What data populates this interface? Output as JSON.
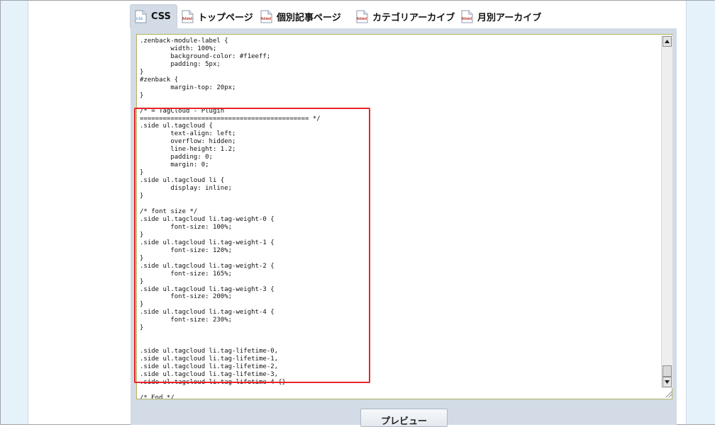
{
  "tabs": [
    {
      "label": "CSS",
      "icon": "css-file-icon",
      "icon_text": "css",
      "active": true
    },
    {
      "label": "トップページ",
      "icon": "html-file-icon",
      "icon_text": "html",
      "active": false
    },
    {
      "label": "個別記事ページ",
      "icon": "html-file-icon",
      "icon_text": "html",
      "active": false
    },
    {
      "label": "カテゴリアーカイブ",
      "icon": "html-file-icon",
      "icon_text": "html",
      "active": false
    },
    {
      "label": "月別アーカイブ",
      "icon": "html-file-icon",
      "icon_text": "html",
      "active": false
    }
  ],
  "editor": {
    "code": ".zenback-module-label {\n        width: 100%;\n        background-color: #f1eeff;\n        padding: 5px;\n}\n#zenback {\n        margin-top: 20px;\n}\n\n/* = TagCloud - Plugin\n============================================ */\n.side ul.tagcloud {\n        text-align: left;\n        overflow: hidden;\n        line-height: 1.2;\n        padding: 0;\n        margin: 0;\n}\n.side ul.tagcloud li {\n        display: inline;\n}\n\n/* font size */\n.side ul.tagcloud li.tag-weight-0 {\n        font-size: 100%;\n}\n.side ul.tagcloud li.tag-weight-1 {\n        font-size: 120%;\n}\n.side ul.tagcloud li.tag-weight-2 {\n        font-size: 165%;\n}\n.side ul.tagcloud li.tag-weight-3 {\n        font-size: 200%;\n}\n.side ul.tagcloud li.tag-weight-4 {\n        font-size: 230%;\n}\n\n\n.side ul.tagcloud li.tag-lifetime-0,\n.side ul.tagcloud li.tag-lifetime-1,\n.side ul.tagcloud li.tag-lifetime-2,\n.side ul.tagcloud li.tag-lifetime-3,\n.side ul.tagcloud li.tag-lifetime-4 {}\n\n/* End */"
  },
  "buttons": {
    "preview_label": "プレビュー"
  },
  "colors": {
    "highlight": "#e8242a",
    "panel": "#d2dbe6",
    "css_icon": "#3a7fc1",
    "html_icon": "#c0392b"
  }
}
